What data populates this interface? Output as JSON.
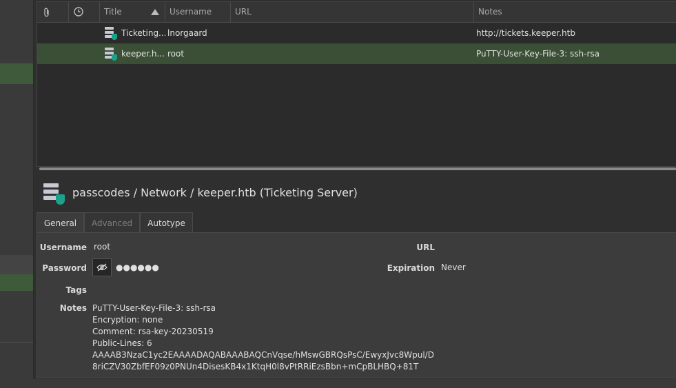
{
  "table": {
    "columns": {
      "attach_icon": "paperclip-icon",
      "time_icon": "clock-icon",
      "title": "Title",
      "username": "Username",
      "url": "URL",
      "notes": "Notes"
    },
    "rows": [
      {
        "title": "Ticketing...",
        "username": "lnorgaard",
        "url": "",
        "notes": "http://tickets.keeper.htb",
        "selected": false
      },
      {
        "title": "keeper.h...",
        "username": "root",
        "url": "",
        "notes": "PuTTY-User-Key-File-3: ssh-rsa",
        "selected": true
      }
    ]
  },
  "detail": {
    "breadcrumb": "passcodes / Network / keeper.htb (Ticketing Server)",
    "tabs": [
      {
        "label": "General",
        "active": true
      },
      {
        "label": "Advanced",
        "active": false,
        "disabled": true
      },
      {
        "label": "Autotype",
        "active": false
      }
    ],
    "fields": {
      "username_label": "Username",
      "username_value": "root",
      "password_label": "Password",
      "password_value": "●●●●●●",
      "tags_label": "Tags",
      "notes_label": "Notes",
      "url_label": "URL",
      "expiration_label": "Expiration",
      "expiration_value": "Never"
    },
    "notes": [
      "PuTTY-User-Key-File-3: ssh-rsa",
      "Encryption: none",
      "Comment: rsa-key-20230519",
      "Public-Lines: 6",
      "AAAAB3NzaC1yc2EAAAADAQABAAABAQCnVqse/hMswGBRQsPsC/EwyxJvc8Wpul/D",
      "8riCZV30ZbfEF09z0PNUn4DisesKB4x1KtqH0l8vPtRRiEzsBbn+mCpBLHBQ+81T"
    ]
  },
  "colors": {
    "accent_green": "#1aa38a",
    "selection": "#3a4f35"
  }
}
